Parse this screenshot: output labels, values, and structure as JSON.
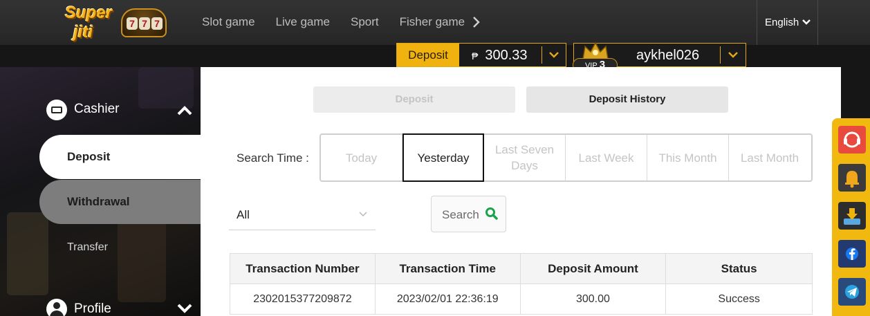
{
  "header": {
    "logo": {
      "line1": "Super",
      "line2": "jiti",
      "reels": [
        "7",
        "7",
        "7"
      ]
    },
    "nav": [
      "Slot game",
      "Live game",
      "Sport",
      "Fisher game"
    ],
    "language": "English"
  },
  "account": {
    "deposit_label": "Deposit",
    "currency_symbol": "₱",
    "balance": "300.33",
    "vip_label": "VIP",
    "vip_level": "3",
    "username": "aykhel026"
  },
  "sidebar": {
    "cashier_label": "Cashier",
    "items": [
      "Deposit",
      "Withdrawal",
      "Transfer"
    ],
    "active_item": "Deposit",
    "profile_label": "Profile"
  },
  "main": {
    "tabs": [
      "Deposit",
      "Deposit History"
    ],
    "active_tab": "Deposit History",
    "search_time_label": "Search Time :",
    "time_options": [
      "Today",
      "Yesterday",
      "Last Seven Days",
      "Last Week",
      "This Month",
      "Last Month"
    ],
    "active_time_option": "Yesterday",
    "filter_value": "All",
    "search_button": "Search",
    "table": {
      "columns": [
        "Transaction Number",
        "Transaction Time",
        "Deposit Amount",
        "Status"
      ],
      "rows": [
        [
          "2302015377209872",
          "2023/02/01 22:36:19",
          "300.00",
          "Success"
        ]
      ]
    }
  },
  "floating_toolbar": {
    "icons": [
      "support-icon",
      "bell-icon",
      "download-icon",
      "facebook-icon",
      "telegram-icon"
    ]
  },
  "colors": {
    "accent": "#f0b20f",
    "header_bg": "#2b2b2b",
    "search_icon": "#1aa34a"
  }
}
